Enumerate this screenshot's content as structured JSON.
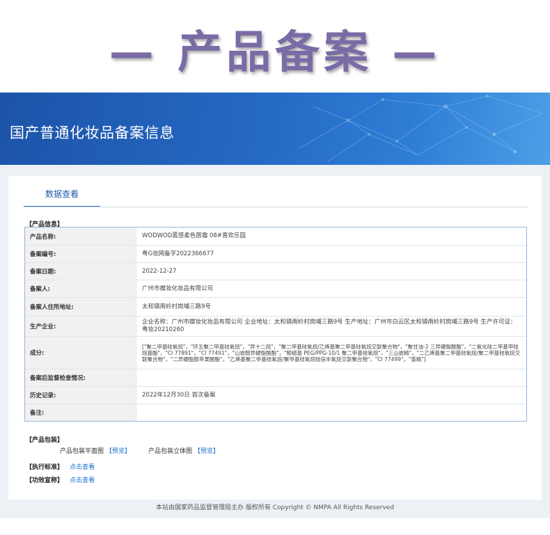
{
  "hero": {
    "title": "— 产品备案 —"
  },
  "banner": {
    "title": "国产普通化妆品备案信息"
  },
  "tabs": {
    "data_view": "数据查看"
  },
  "product_info": {
    "section_label": "【产品信息】",
    "rows": [
      {
        "label": "产品名称:",
        "value": "WODWOD雾感柔色唇霜 08#喜欢乐园"
      },
      {
        "label": "备案编号:",
        "value": "粤G妆网备字2022366677"
      },
      {
        "label": "备案日期:",
        "value": "2022-12-27"
      },
      {
        "label": "备案人:",
        "value": "广州市蝶妆化妆品有限公司"
      },
      {
        "label": "备案人住所地址:",
        "value": "太和镇南岭村岗埔三路9号"
      },
      {
        "label": "生产企业:",
        "value": "企业名称：广州市蝶妆化妆品有限公司 企业地址：太和镇南岭村岗埔三路9号 生产地址：广州市白云区太和镇南岭村岗埔三路9号 生产许可证：粤妆20210260"
      },
      {
        "label": "成分:",
        "value": "[\"聚二甲基硅氧烷\"，\"环五聚二甲基硅氧烷\"，\"异十二烷\"，\"聚二甲基硅氧烷/乙烯基聚二甲基硅氧烷交联聚合物\"，\"聚甘油-2 三异硬脂酸酯\"，\"二氧化硅二甲基甲硅烷基酯\"，\"CI 77891\"，\"CI 77491\"，\"山嵛醇异硬脂酸酯\"，\"鲸蜡基 PEG/PPG-10/1 聚二甲基硅氧烷\"，\"三山嵛精\"，\"二乙烯基聚二甲基硅氧烷/聚二甲基硅氧烷交联聚合物\"，\"二异硬脂醇苹果酸酯\"，\"乙烯基聚二甲基硅氧烷/聚甲基硅氧烷硅倍半氧烷交联聚合物\"，\"CI 77499\"，\"香精\"]"
      },
      {
        "label": "备案后监督检查情况:",
        "value": ""
      },
      {
        "label": "历史记录:",
        "value": "2022年12月30日 首次备案"
      },
      {
        "label": "备注:",
        "value": ""
      }
    ]
  },
  "packaging": {
    "section_label": "【产品包装】",
    "flat_label": "产品包装平面图",
    "flat_preview": "【预览】",
    "stereo_label": "产品包装立体图",
    "stereo_preview": "【预览】"
  },
  "standard": {
    "label": "【执行标准】",
    "link": "点击查看"
  },
  "efficacy": {
    "label": "【功效宣称】",
    "link": "点击查看"
  },
  "footer": {
    "text": "本站由国家药品监督管理局主办 版权所有 Copyright © NMPA All Rights Reserved"
  }
}
